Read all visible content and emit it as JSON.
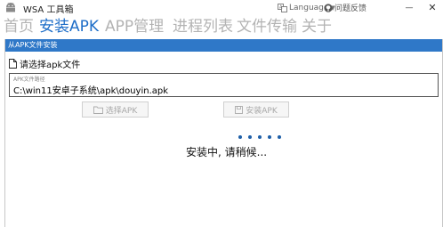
{
  "window": {
    "title": "WSA 工具箱",
    "language_label": "Language",
    "feedback_label": "问题反馈",
    "minimize_glyph": "—",
    "close_glyph": "✕"
  },
  "nav": {
    "tabs": [
      {
        "label": "首页",
        "active": false
      },
      {
        "label": "安装APK",
        "active": true
      },
      {
        "label": "APP管理",
        "active": false
      },
      {
        "label": "进程列表",
        "active": false
      },
      {
        "label": "文件传输",
        "active": false
      },
      {
        "label": "关于",
        "active": false
      }
    ]
  },
  "install_panel": {
    "header": "从APK文件安装",
    "select_label": "请选择apk文件",
    "path_label": "APK文件路径",
    "path_value": "C:\\win11安卓子系统\\apk\\douyin.apk",
    "select_button": "选择APK",
    "install_button": "安装APK",
    "status_text": "安装中, 请稍候..."
  },
  "colors": {
    "accent": "#1e6ec8",
    "header_bg": "#2f78c8",
    "inactive_tab": "#b3b3b3",
    "spinner": "#1e5fa8"
  }
}
